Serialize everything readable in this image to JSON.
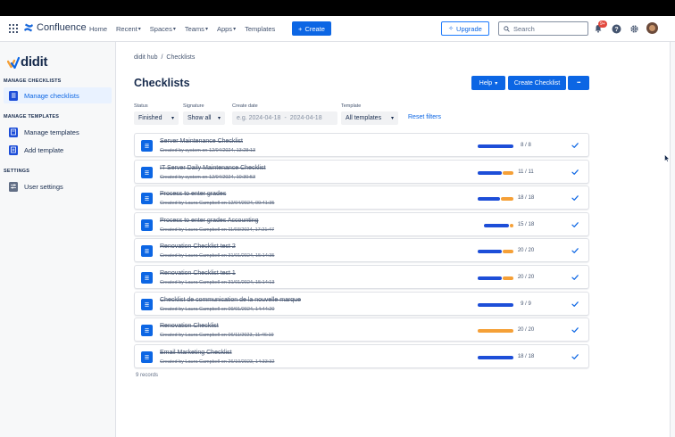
{
  "topnav": {
    "logo_text": "Confluence",
    "items": [
      {
        "label": "Home",
        "dropdown": false
      },
      {
        "label": "Recent",
        "dropdown": true
      },
      {
        "label": "Spaces",
        "dropdown": true
      },
      {
        "label": "Teams",
        "dropdown": true
      },
      {
        "label": "Apps",
        "dropdown": true
      },
      {
        "label": "Templates",
        "dropdown": false
      }
    ],
    "create_label": "Create",
    "upgrade_label": "Upgrade",
    "search_placeholder": "Search",
    "notification_count": "9+"
  },
  "sidebar": {
    "brand": "didit",
    "sections": [
      {
        "title": "MANAGE CHECKLISTS",
        "items": [
          {
            "label": "Manage checklists",
            "active": true,
            "icon": "checklist-icon"
          }
        ]
      },
      {
        "title": "MANAGE TEMPLATES",
        "items": [
          {
            "label": "Manage templates",
            "active": false,
            "icon": "template-icon"
          },
          {
            "label": "Add template",
            "active": false,
            "icon": "add-template-icon"
          }
        ]
      },
      {
        "title": "SETTINGS",
        "items": [
          {
            "label": "User settings",
            "active": false,
            "icon": "sliders-icon"
          }
        ]
      }
    ]
  },
  "main": {
    "breadcrumb": [
      "didit hub",
      "/",
      "Checklists"
    ],
    "title": "Checklists",
    "help_label": "Help",
    "create_checklist_label": "Create Checklist",
    "more_label": "•••",
    "filters": {
      "status_label": "Status",
      "status_value": "Finished",
      "signature_label": "Signature",
      "signature_value": "Show all",
      "create_date_label": "Create date",
      "date_from_placeholder": "e.g. 2024-04-18",
      "date_separator": "-",
      "date_to_placeholder": "2024-04-18",
      "template_label": "Template",
      "template_value": "All templates",
      "reset_label": "Reset filters"
    },
    "records_label": "9 records"
  },
  "colors": {
    "accent": "#0c66e4",
    "progress_blue": "#1d4ed8",
    "progress_orange": "#f5a037",
    "sidebar_active_bg": "#e9f2ff"
  },
  "checklists": [
    {
      "title": "Server Maintenance Checklist",
      "meta": "Created by system on 12/04/2024, 13:28:13",
      "done": 8,
      "total": 8,
      "progress": "8 / 8",
      "orange_fraction": 0.0
    },
    {
      "title": "IT Server Daily Maintenance Checklist",
      "meta": "Created by system on 12/04/2024, 10:30:53",
      "done": 11,
      "total": 11,
      "progress": "11 / 11",
      "orange_fraction": 0.3
    },
    {
      "title": "Process to enter grades",
      "meta": "Created by Laura Campbell on 12/04/2024, 09:41:35",
      "done": 18,
      "total": 18,
      "progress": "18 / 18",
      "orange_fraction": 0.35
    },
    {
      "title": "Process to enter grades Accounting",
      "meta": "Created by Laura Campbell on 11/03/2024, 17:21:47",
      "done": 15,
      "total": 18,
      "progress": "15 / 18",
      "orange_fraction": 0.12
    },
    {
      "title": "Renovation Checklist test 2",
      "meta": "Created by Laura Campbell on 31/01/2024, 15:14:35",
      "done": 20,
      "total": 20,
      "progress": "20 / 20",
      "orange_fraction": 0.3
    },
    {
      "title": "Renovation Checklist test 1",
      "meta": "Created by Laura Campbell on 31/01/2024, 15:14:13",
      "done": 20,
      "total": 20,
      "progress": "20 / 20",
      "orange_fraction": 0.3
    },
    {
      "title": "Checklist de communication de la nouvelle marque",
      "meta": "Created by Laura Campbell on 09/01/2024, 14:44:20",
      "done": 9,
      "total": 9,
      "progress": "9 / 9",
      "orange_fraction": 0.0
    },
    {
      "title": "Renovation Checklist",
      "meta": "Created by Laura Campbell on 06/11/2023, 11:46:19",
      "done": 20,
      "total": 20,
      "progress": "20 / 20",
      "orange_fraction": 1.0
    },
    {
      "title": "Email Marketing Checklist",
      "meta": "Created by Laura Campbell on 26/10/2023, 14:33:32",
      "done": 18,
      "total": 18,
      "progress": "18 / 18",
      "orange_fraction": 0.0
    }
  ]
}
